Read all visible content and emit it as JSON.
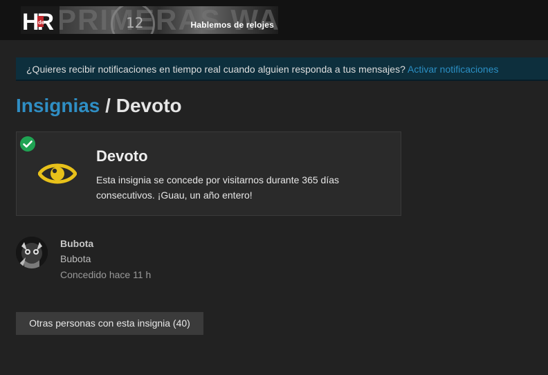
{
  "header": {
    "logo_text": "HR",
    "logo_small": "de",
    "tagline": "Hablemos de relojes",
    "dial_number": "12"
  },
  "notice": {
    "text": "¿Quieres recibir notificaciones en tiempo real cuando alguien responda a tus mensajes? ",
    "link": "Activar notificaciones"
  },
  "title": {
    "crumb": "Insignias",
    "separator": " / ",
    "current": "Devoto"
  },
  "badge": {
    "name": "Devoto",
    "description": "Esta insignia se concede por visitarnos durante 365 días consecutivos. ¡Guau, un año entero!",
    "icon": "eye-icon",
    "granted_icon": "check-circle-icon",
    "icon_color": "#e8c11a",
    "check_color": "#1fa353"
  },
  "grantee": {
    "username": "Bubota",
    "title": "Bubota",
    "granted": "Concedido hace 11 h"
  },
  "others_button": "Otras personas con esta insignia (40)",
  "colors": {
    "link": "#2f8ec4",
    "notice_bg": "#0d2f3d",
    "background": "#222222"
  }
}
